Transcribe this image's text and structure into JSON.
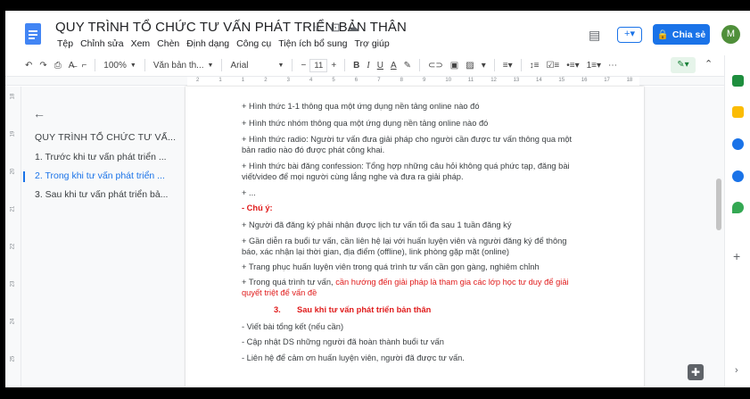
{
  "document": {
    "title": "QUY TRÌNH TỔ CHỨC TƯ VẤN PHÁT TRIỂN BẢN THÂN"
  },
  "header": {
    "menu": [
      "Tệp",
      "Chỉnh sửa",
      "Xem",
      "Chèn",
      "Định dạng",
      "Công cụ",
      "Tiện ích bổ sung",
      "Trợ giúp"
    ],
    "share_label": "Chia sẻ",
    "avatar_initial": "M"
  },
  "toolbar": {
    "zoom": "100%",
    "style": "Văn bản th...",
    "font": "Arial",
    "font_size": "11",
    "text_color_glyph": "A"
  },
  "ruler": {
    "h_ticks": [
      "2",
      "1",
      "1",
      "2",
      "3",
      "4",
      "5",
      "6",
      "7",
      "8",
      "9",
      "10",
      "11",
      "12",
      "13",
      "14",
      "15",
      "16",
      "17",
      "18"
    ],
    "v_ticks": [
      "18",
      "19",
      "20",
      "21",
      "22",
      "23",
      "24",
      "25"
    ]
  },
  "outline": {
    "title": "QUY TRÌNH TỔ CHỨC TƯ VẤ...",
    "items": [
      "1. Trước khi tư vấn phát triển ...",
      "2. Trong khi tư vấn phát triển ...",
      "3. Sau khi tư vấn phát triển bả..."
    ],
    "active_index": 1
  },
  "body": {
    "l1": "+ Hình thức 1-1 thông qua một ứng dụng nền tảng online nào đó",
    "l2": "+ Hình thức nhóm thông qua một ứng dụng nền tảng online nào đó",
    "l3a": "+ Hình thức radio: Người tư vấn đưa giải pháp cho người cần được tư vấn thông qua một",
    "l3b": "bản radio nào đó được phát công khai.",
    "l4a": "+ Hình thức bài đăng confession: Tổng hợp những câu hỏi không quá phức tạp, đăng bài",
    "l4b": "viết/video để mọi người cùng lắng nghe và đưa ra giải pháp.",
    "l5": "+ ...",
    "note": "- Chú ý:",
    "n1": "+ Người đã đăng ký phải nhận được lịch tư vấn tối đa sau 1 tuần đăng ký",
    "n2a": "+ Gần diễn ra buổi tư vấn, cần liên hệ lại với huấn luyện viên và người đăng ký để thông",
    "n2b": "báo, xác nhận lại thời gian, địa điểm (offline), link phòng gặp mặt (online)",
    "n3": "+ Trang phục huấn luyện viên trong quá trình tư vấn cần gọn gàng, nghiêm chỉnh",
    "n4_plain": "+ Trong quá trình tư vấn, ",
    "n4_red": "cần hướng đến giải pháp là tham gia các lớp học tư duy để giải",
    "n4b_red": "quyết triệt để vấn đề",
    "h3_num": "3.",
    "h3_text": "Sau khi tư vấn phát triển bản thân",
    "s1": "- Viết bài tổng kết (nếu cần)",
    "s2": "- Cập nhật DS những người đã hoàn thành buổi tư vấn",
    "s3": "- Liên hệ để cảm ơn huấn luyện viên, người đã được tư vấn."
  },
  "colors": {
    "accent": "#1a73e8",
    "red_text": "#e01b1b",
    "avatar": "#4f8f3a"
  }
}
